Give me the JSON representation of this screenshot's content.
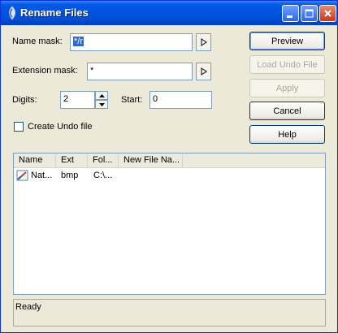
{
  "window": {
    "title": "Rename Files"
  },
  "form": {
    "name_mask_label": "Name mask:",
    "name_mask_value": "*/r",
    "extension_mask_label": "Extension mask:",
    "extension_mask_value": "*",
    "digits_label": "Digits:",
    "digits_value": "2",
    "start_label": "Start:",
    "start_value": "0",
    "create_undo_label": "Create Undo file",
    "create_undo_checked": false
  },
  "buttons": {
    "preview": "Preview",
    "load_undo": "Load Undo File",
    "apply": "Apply",
    "cancel": "Cancel",
    "help": "Help"
  },
  "list": {
    "columns": [
      "Name",
      "Ext",
      "Fol...",
      "New File Na..."
    ],
    "rows": [
      {
        "name": "Nat...",
        "ext": "bmp",
        "folder": "C:\\...",
        "new_name": ""
      }
    ]
  },
  "status": {
    "text": "Ready"
  }
}
